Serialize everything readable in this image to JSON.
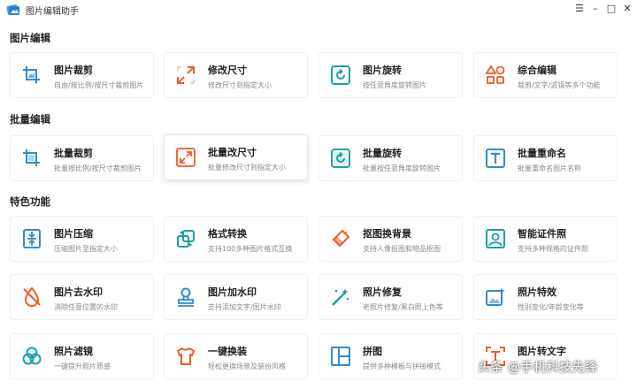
{
  "window": {
    "title": "图片编辑助手",
    "controls": {
      "menu": "☰",
      "minimize": "–",
      "maximize": "□",
      "close": "✕"
    }
  },
  "sections": [
    {
      "title": "图片编辑",
      "items": [
        {
          "name": "图片裁剪",
          "desc": "自由/按比例/按尺寸裁剪图片",
          "icon": "crop-icon"
        },
        {
          "name": "修改尺寸",
          "desc": "修改尺寸到指定大小",
          "icon": "resize-icon"
        },
        {
          "name": "图片旋转",
          "desc": "按任意角度旋转图片",
          "icon": "rotate-icon"
        },
        {
          "name": "综合编辑",
          "desc": "裁剪/文字/滤镜等多个功能",
          "icon": "shapes-icon"
        }
      ]
    },
    {
      "title": "批量编辑",
      "items": [
        {
          "name": "批量裁剪",
          "desc": "批量按比例/按尺寸裁剪图片",
          "icon": "crop-icon"
        },
        {
          "name": "批量改尺寸",
          "desc": "批量修改尺寸到指定大小",
          "icon": "resize-icon"
        },
        {
          "name": "批量旋转",
          "desc": "批量按任意角度旋转图片",
          "icon": "rotate-icon"
        },
        {
          "name": "批量重命名",
          "desc": "批量重命名图片名称",
          "icon": "text-icon"
        }
      ]
    },
    {
      "title": "特色功能",
      "items": [
        {
          "name": "图片压缩",
          "desc": "压缩图片至指定大小",
          "icon": "compress-icon"
        },
        {
          "name": "格式转换",
          "desc": "支持100多种图片格式互换",
          "icon": "convert-icon"
        },
        {
          "name": "抠图换背景",
          "desc": "支持人像抠图和物品抠图",
          "icon": "eraser-icon"
        },
        {
          "name": "智能证件照",
          "desc": "支持多种规格的证件照",
          "icon": "id-photo-icon"
        },
        {
          "name": "图片去水印",
          "desc": "消除任意位置的水印",
          "icon": "no-watermark-icon"
        },
        {
          "name": "图片加水印",
          "desc": "支持添加文字/图片水印",
          "icon": "stamp-icon"
        },
        {
          "name": "照片修复",
          "desc": "老照片修复/黑白照上色等",
          "icon": "magic-wand-icon"
        },
        {
          "name": "照片特效",
          "desc": "性别变化/年龄变化等",
          "icon": "sparkle-image-icon"
        },
        {
          "name": "照片滤镜",
          "desc": "一键提升照片质感",
          "icon": "filter-icon"
        },
        {
          "name": "一键换装",
          "desc": "轻松更换场景及装扮风格",
          "icon": "shirt-icon"
        },
        {
          "name": "拼图",
          "desc": "提供多种模板与拼接模式",
          "icon": "collage-icon"
        },
        {
          "name": "图片转文字",
          "desc": "",
          "icon": "image-to-text-icon"
        }
      ]
    }
  ],
  "watermark": "头条 @手机科技先锋",
  "colors": {
    "blue": "#2f8bd8",
    "orange": "#f05a28",
    "teal": "#17a2a2"
  }
}
